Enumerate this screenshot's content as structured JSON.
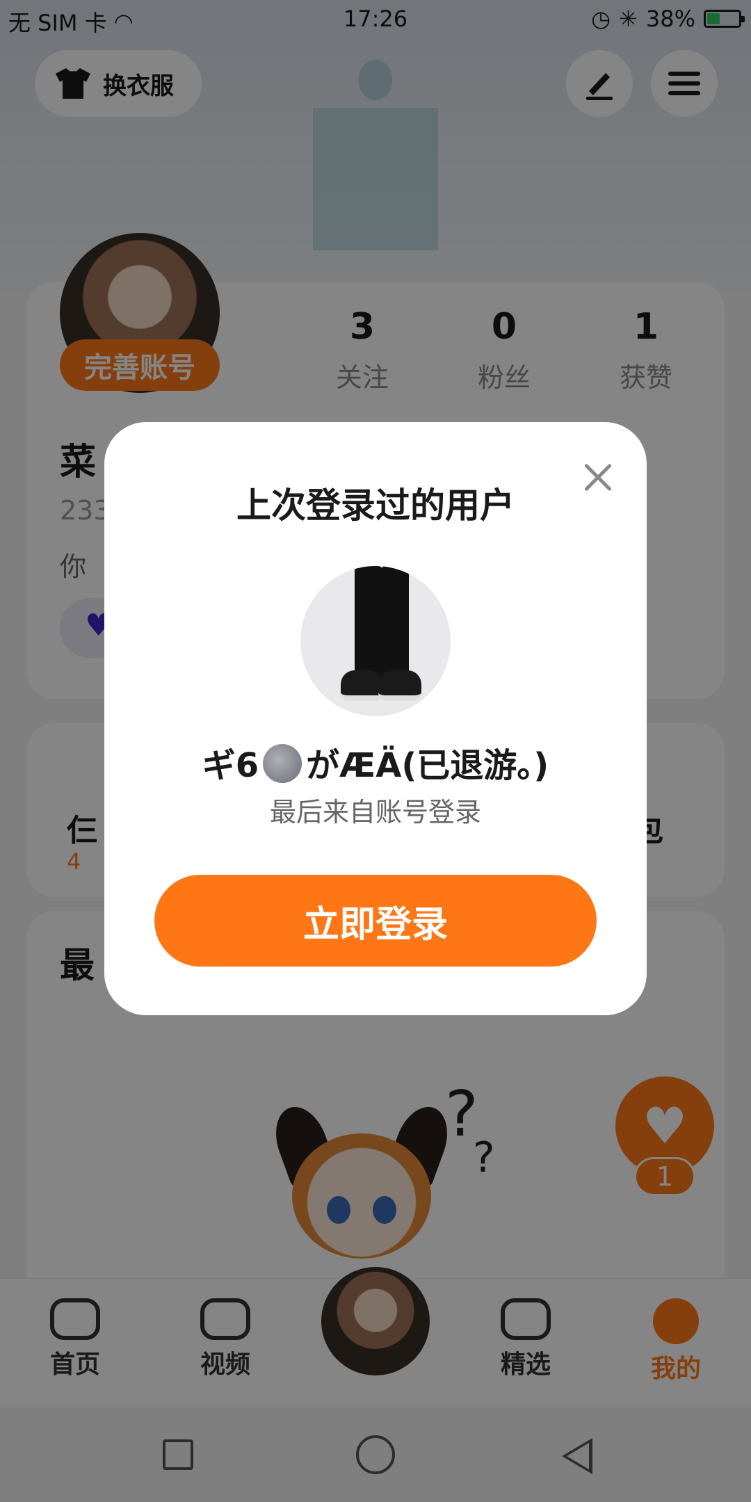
{
  "status_bar": {
    "carrier": "无 SIM 卡",
    "time": "17:26",
    "battery": "38%",
    "battery_level": 0.38
  },
  "header": {
    "outfit_label": "换衣服",
    "edit_icon": "pen-icon",
    "menu_icon": "menu-icon"
  },
  "profile": {
    "complete_label": "完善账号",
    "stats": [
      {
        "num": "3",
        "label": "关注"
      },
      {
        "num": "0",
        "label": "粉丝"
      },
      {
        "num": "1",
        "label": "获赞"
      }
    ],
    "nick_partial": "菜",
    "uid_partial": "233",
    "bio_partial": "你"
  },
  "mid": {
    "left_partial": "仨",
    "left_sub_partial": "4",
    "right_partial": "包"
  },
  "recent": {
    "title_partial": "最"
  },
  "like_button": {
    "count": "1"
  },
  "bottom_nav": {
    "items": [
      {
        "label": "首页",
        "icon": "gamepad-icon"
      },
      {
        "label": "视频",
        "icon": "play-icon"
      },
      {
        "label": "精选",
        "icon": "heart-badge-icon"
      },
      {
        "label": "我的",
        "icon": "face-icon"
      }
    ]
  },
  "modal": {
    "title": "上次登录过的用户",
    "username_prefix": "ギ6",
    "username_suffix": "がÆÄ(已退游。)",
    "subtitle": "最后来自账号登录",
    "login_label": "立即登录"
  },
  "colors": {
    "accent": "#ff7614",
    "overlay": "#000000"
  }
}
